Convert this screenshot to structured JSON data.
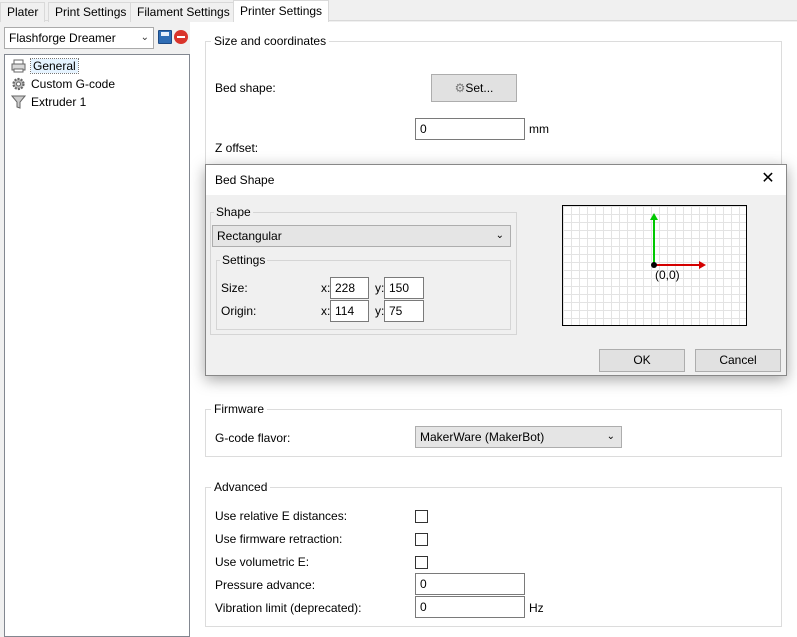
{
  "tabs": [
    "Plater",
    "Print Settings",
    "Filament Settings",
    "Printer Settings"
  ],
  "active_tab": "Printer Settings",
  "left": {
    "preset": "Flashforge Dreamer",
    "tree": [
      {
        "label": "General",
        "icon": "printer-icon"
      },
      {
        "label": "Custom G-code",
        "icon": "cog-icon"
      },
      {
        "label": "Extruder 1",
        "icon": "funnel-icon"
      }
    ]
  },
  "size_group": {
    "title": "Size and coordinates",
    "bed_shape_label": "Bed shape:",
    "set_button": "Set...",
    "z_offset_label": "Z offset:",
    "z_offset_value": "0",
    "z_offset_unit": "mm"
  },
  "dialog": {
    "title": "Bed Shape",
    "shape_group_title": "Shape",
    "shape_value": "Rectangular",
    "settings_title": "Settings",
    "size_label": "Size:",
    "origin_label": "Origin:",
    "x_prefix": "x:",
    "y_prefix": "y:",
    "size_x": "228",
    "size_y": "150",
    "origin_x": "114",
    "origin_y": "75",
    "origin_text": "(0,0)",
    "ok_label": "OK",
    "cancel_label": "Cancel"
  },
  "firmware": {
    "title": "Firmware",
    "flavor_label": "G-code flavor:",
    "flavor_value": "MakerWare (MakerBot)"
  },
  "advanced": {
    "title": "Advanced",
    "relative_e_label": "Use relative E distances:",
    "firmware_retraction_label": "Use firmware retraction:",
    "volumetric_e_label": "Use volumetric E:",
    "pressure_advance_label": "Pressure advance:",
    "pressure_advance_value": "0",
    "vibration_limit_label": "Vibration limit (deprecated):",
    "vibration_limit_value": "0",
    "vibration_limit_unit": "Hz"
  },
  "colors": {
    "y_axis": "#00c800",
    "x_axis": "#d40000"
  }
}
